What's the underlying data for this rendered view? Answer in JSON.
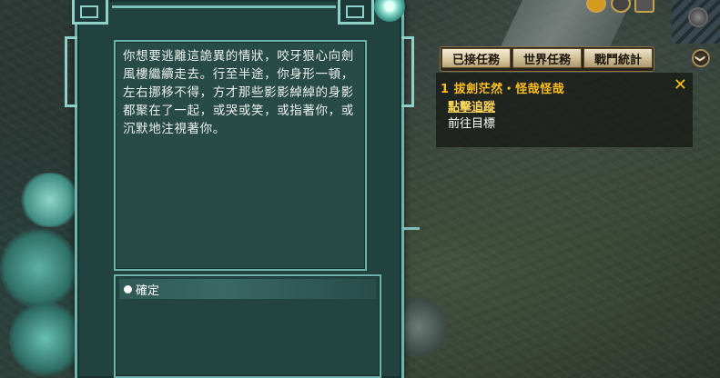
{
  "dialog": {
    "story_text": "你想要逃離這詭異的情狀，咬牙狠心向劍風樓繼續走去。行至半途，你身形一頓，左右挪移不得，方才那些影影綽綽的身影都聚在了一起，或哭或笑，或指著你，或沉默地注視著你。",
    "options": [
      {
        "label": "確定"
      }
    ]
  },
  "quest_tracker": {
    "tabs": [
      {
        "label": "已接任務",
        "active": true
      },
      {
        "label": "世界任務",
        "active": false
      },
      {
        "label": "戰鬥統計",
        "active": false
      }
    ],
    "quest": {
      "title": "1  拔劍茫然・怪哉怪哉",
      "link": "點擊追蹤",
      "detail": "前往目標",
      "close_symbol": "✕"
    },
    "collapse_symbol": "❯"
  },
  "colors": {
    "dialog_bg": "#21423f",
    "dialog_border": "#6fb3ad",
    "quest_title": "#ffbf1f",
    "tab_bg": "#c9b88f"
  },
  "icons": [
    "chevron-down-icon",
    "close-icon",
    "bullet-icon",
    "lotus-ornament-icon"
  ]
}
